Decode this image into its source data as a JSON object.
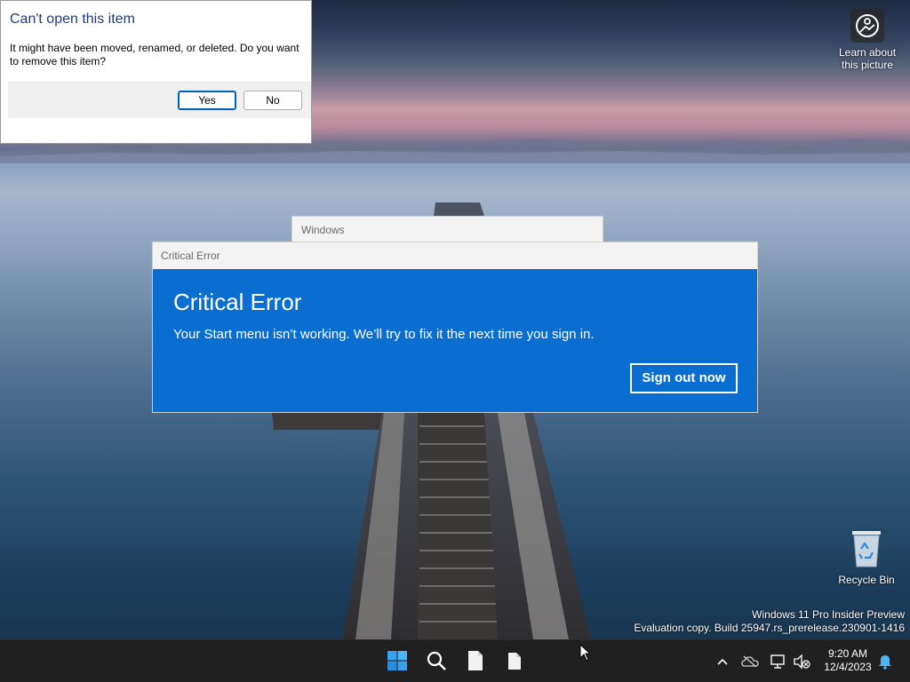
{
  "desktop": {
    "learn_label_line1": "Learn about",
    "learn_label_line2": "this picture",
    "recycle_bin_label": "Recycle Bin",
    "watermark_line1": "Windows 11 Pro Insider Preview",
    "watermark_line2": "Evaluation copy. Build 25947.rs_prerelease.230901-1416"
  },
  "cant_open_dialog": {
    "title": "Can't open this item",
    "message": "It might have been moved, renamed, or deleted. Do you want to remove this item?",
    "yes_label": "Yes",
    "no_label": "No"
  },
  "windows_window": {
    "title": "Windows"
  },
  "critical_error": {
    "window_title": "Critical Error",
    "heading": "Critical Error",
    "message": "Your Start menu isn’t working. We’ll try to fix it the next time you sign in.",
    "sign_out_label": "Sign out now"
  },
  "taskbar": {
    "time": "9:20 AM",
    "date": "12/4/2023",
    "icons": [
      "start-icon",
      "search-icon",
      "file-icon",
      "file-icon"
    ],
    "tray_icons": [
      "chevron-up-icon",
      "onedrive-offline-icon",
      "network-icon",
      "volume-muted-icon",
      "notification-bell-icon"
    ]
  },
  "colors": {
    "accent": "#0a6ed1",
    "taskbar": "#202020",
    "dialog_title": "#1e3b78"
  }
}
